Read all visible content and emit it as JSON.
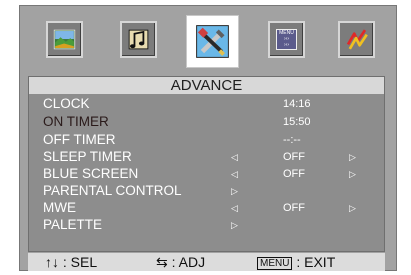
{
  "tabs": [
    {
      "name": "picture",
      "icon": "picture-icon"
    },
    {
      "name": "audio",
      "icon": "audio-icon"
    },
    {
      "name": "advance",
      "icon": "tools-icon",
      "selected": true
    },
    {
      "name": "menu",
      "icon": "menu-icon",
      "text": "MENU"
    },
    {
      "name": "channel",
      "icon": "antenna-icon"
    }
  ],
  "panel": {
    "title": "ADVANCE",
    "items": [
      {
        "label": "CLOCK",
        "value": "14:16"
      },
      {
        "label": "ON TIMER",
        "value": "15:50",
        "active": true
      },
      {
        "label": "OFF TIMER",
        "value": "--:--"
      },
      {
        "label": "SLEEP TIMER",
        "value": "OFF",
        "left_arrow": "◁",
        "right_arrow": "▷"
      },
      {
        "label": "BLUE SCREEN",
        "value": "OFF",
        "left_arrow": "◁",
        "right_arrow": "▷"
      },
      {
        "label": "PARENTAL CONTROL",
        "value": "",
        "right_arrow": "▷"
      },
      {
        "label": "MWE",
        "value": "OFF",
        "left_arrow": "◁",
        "right_arrow": "▷"
      },
      {
        "label": "PALETTE",
        "value": "",
        "right_arrow": "▷"
      }
    ]
  },
  "footer": {
    "sel_icon": "↑↓",
    "sel_label": ": SEL",
    "adj_icon": "⇆",
    "adj_label": ": ADJ",
    "exit_key": "MENU",
    "exit_label": ": EXIT"
  },
  "colors": {
    "frame": "#a2a2a2",
    "panel": "#8d8d8d",
    "title_bar": "#d8d8d8",
    "active_item": "#2a1a1a"
  }
}
